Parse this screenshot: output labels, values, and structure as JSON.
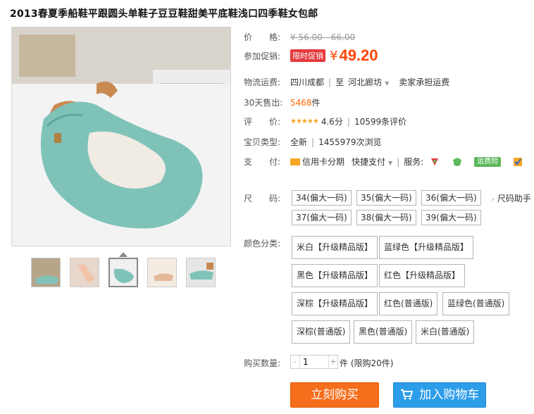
{
  "title": "2013春夏季船鞋平跟圆头单鞋子豆豆鞋甜美平底鞋浅口四季鞋女包邮",
  "price": {
    "label": "价　　格:",
    "value": "¥ 56.00 - 66.00"
  },
  "promo": {
    "label": "参加促销:",
    "tag": "限时促销",
    "currency": "¥",
    "value": "49.20"
  },
  "shipping": {
    "label": "物流运费:",
    "from": "四川成都",
    "to_word": "至",
    "to": "河北廊坊",
    "fee": "卖家承担运费"
  },
  "sales": {
    "label": "30天售出:",
    "count": "5468",
    "unit": "件"
  },
  "rating": {
    "label": "评　　价:",
    "stars": "★★★★★",
    "score": "4.6分",
    "reviews": "10599条评价"
  },
  "type": {
    "label": "宝贝类型:",
    "condition": "全新",
    "views": "1455979次浏览"
  },
  "payment": {
    "label": "支　　付:",
    "installment": "信用卡分期",
    "quick_pay": "快捷支付",
    "service_label": "服务:",
    "badge": "运费险"
  },
  "size": {
    "label": "尺　　码:",
    "guide": "尺码助手",
    "options": [
      "34(偏大一码)",
      "35(偏大一码)",
      "36(偏大一码)",
      "37(偏大一码)",
      "38(偏大一码)",
      "39(偏大一码)"
    ]
  },
  "color": {
    "label": "颜色分类:",
    "options": [
      "米白【升级精品版】",
      "蓝绿色【升级精品版】",
      "黑色【升级精品版】",
      "红色【升级精品版】",
      "深棕【升级精品版】",
      "红色(普通版)",
      "蓝绿色(普通版)",
      "深棕(普通版)",
      "黑色(普通版)",
      "米白(普通版)"
    ]
  },
  "quantity": {
    "label": "购买数量:",
    "value": "1",
    "unit": "件",
    "limit": "(限购20件)"
  },
  "buttons": {
    "buy_now": "立刻购买",
    "add_cart": "加入购物车"
  },
  "colors": {
    "accent": "#ff4400",
    "buy": "#f66d1b",
    "cart": "#2c9de9"
  }
}
